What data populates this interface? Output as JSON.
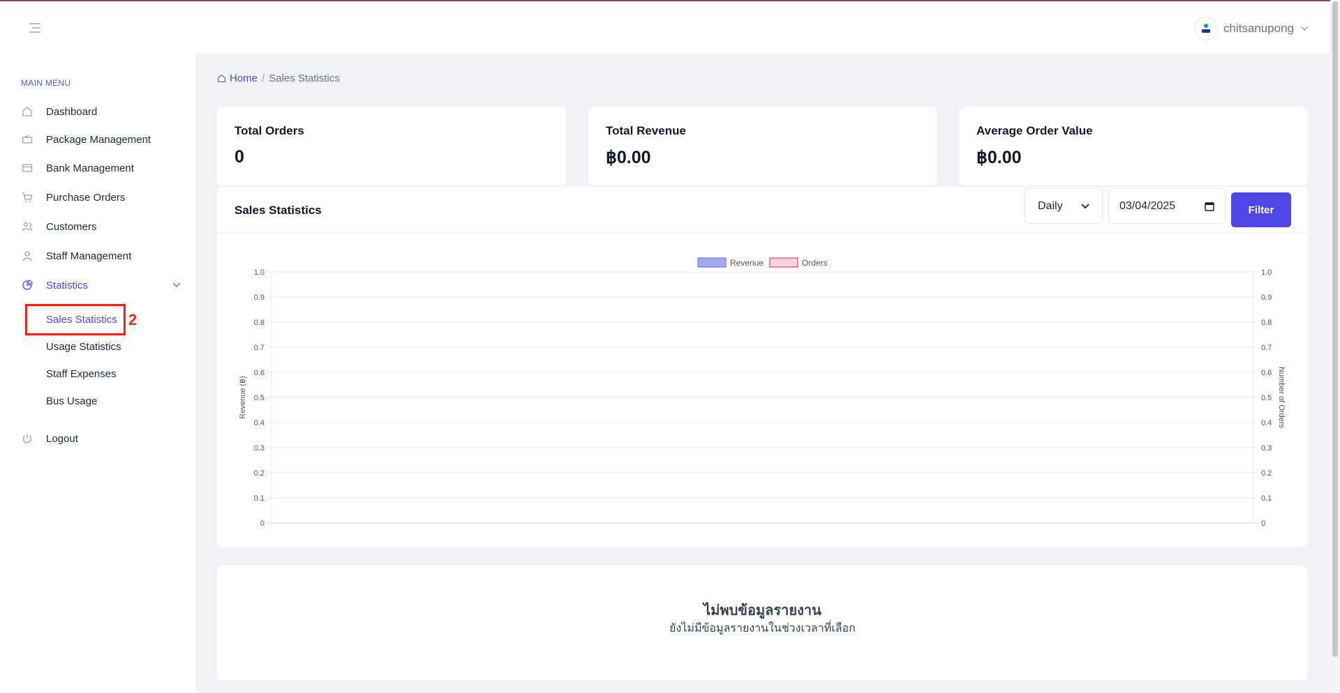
{
  "header": {
    "username": "chitsanupong"
  },
  "sidebar": {
    "menu_header": "MAIN MENU",
    "items": [
      {
        "label": "Dashboard",
        "icon": "home-icon"
      },
      {
        "label": "Package Management",
        "icon": "ticket-icon"
      },
      {
        "label": "Bank Management",
        "icon": "credit-card-icon"
      },
      {
        "label": "Purchase Orders",
        "icon": "cart-icon"
      },
      {
        "label": "Customers",
        "icon": "users-icon"
      },
      {
        "label": "Staff Management",
        "icon": "user-icon"
      },
      {
        "label": "Statistics",
        "icon": "pie-chart-icon"
      }
    ],
    "sub_items": [
      {
        "label": "Sales Statistics",
        "active": true
      },
      {
        "label": "Usage Statistics"
      },
      {
        "label": "Staff Expenses"
      },
      {
        "label": "Bus Usage"
      }
    ],
    "logout_label": "Logout",
    "annotation_number": "2"
  },
  "breadcrumb": {
    "home": "Home",
    "separator": "/",
    "current": "Sales Statistics"
  },
  "stats": [
    {
      "label": "Total Orders",
      "value": "0"
    },
    {
      "label": "Total Revenue",
      "value": "฿0.00"
    },
    {
      "label": "Average Order Value",
      "value": "฿0.00"
    }
  ],
  "chart_section": {
    "title": "Sales Statistics",
    "period_value": "Daily",
    "date_value": "03/04/2025",
    "filter_label": "Filter"
  },
  "chart_data": {
    "type": "bar",
    "categories": [],
    "series": [
      {
        "name": "Revenue",
        "values": [],
        "color": "#a5a8f0"
      },
      {
        "name": "Orders",
        "values": [],
        "color": "#f5d5dc"
      }
    ],
    "ylabel": "Revenue (฿)",
    "y2label": "Number of Orders",
    "ylim": [
      0,
      1
    ],
    "y2lim": [
      0,
      1
    ],
    "yticks": [
      "0",
      "0.1",
      "0.2",
      "0.3",
      "0.4",
      "0.5",
      "0.6",
      "0.7",
      "0.8",
      "0.9",
      "1.0"
    ],
    "grid": true,
    "legend": "top-center"
  },
  "report": {
    "title": "ไม่พบข้อมูลรายงาน",
    "subtitle": "ยังไม่มีข้อมูลรายงานในช่วงเวลาที่เลือก"
  },
  "colors": {
    "accent": "#4f46e5",
    "annotation": "#e8261c"
  }
}
